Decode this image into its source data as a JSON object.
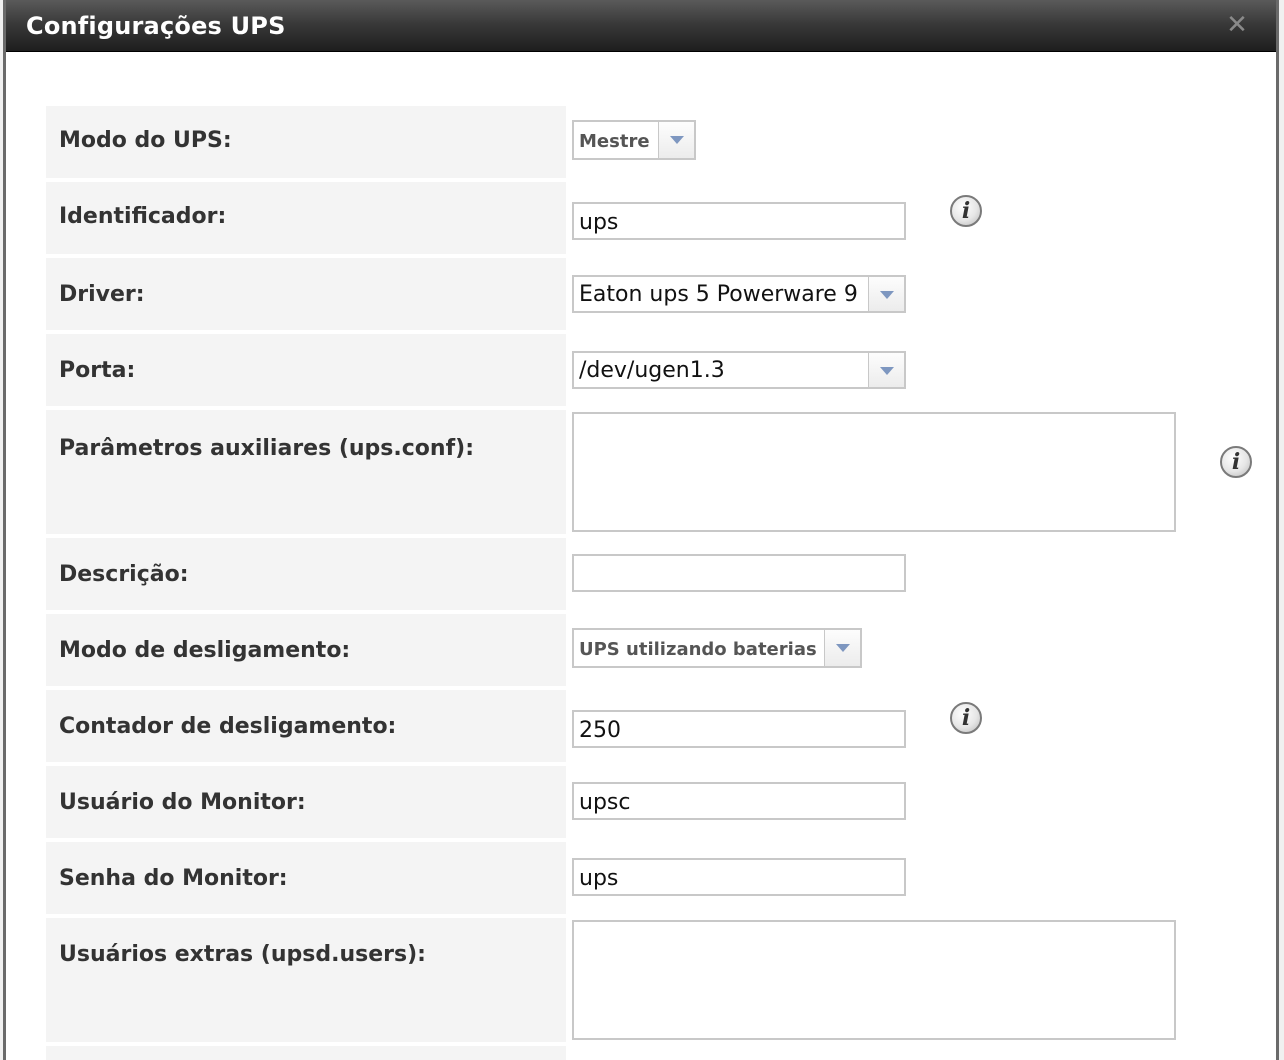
{
  "dialog": {
    "title": "Configurações UPS",
    "close_icon": "close-icon"
  },
  "form": {
    "ups_mode": {
      "label": "Modo do UPS:",
      "value": "Mestre"
    },
    "identifier": {
      "label": "Identificador:",
      "value": "ups"
    },
    "driver": {
      "label": "Driver:",
      "value": "Eaton ups 5 Powerware 9"
    },
    "port": {
      "label": "Porta:",
      "value": "/dev/ugen1.3"
    },
    "aux_params": {
      "label": "Parâmetros auxiliares (ups.conf):",
      "value": ""
    },
    "description": {
      "label": "Descrição:",
      "value": ""
    },
    "shutdown_mode": {
      "label": "Modo de desligamento:",
      "value": "UPS utilizando baterias"
    },
    "shutdown_timer": {
      "label": "Contador de desligamento:",
      "value": "250"
    },
    "monitor_user": {
      "label": "Usuário do Monitor:",
      "value": "upsc"
    },
    "monitor_password": {
      "label": "Senha do Monitor:",
      "value": "ups"
    },
    "extra_users": {
      "label": "Usuários extras (upsd.users):",
      "value": ""
    }
  },
  "icons": {
    "info": "i"
  }
}
